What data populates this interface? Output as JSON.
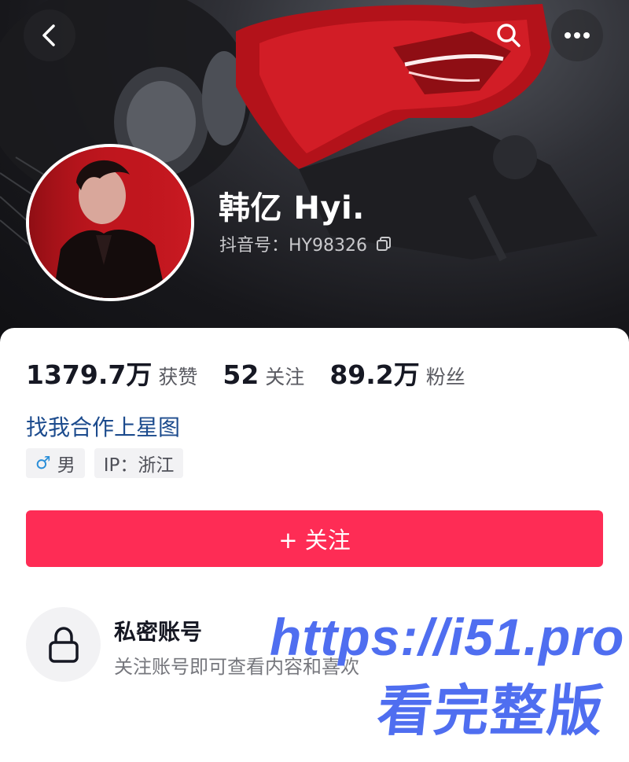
{
  "profile": {
    "nickname": "韩亿 Hyi.",
    "douyin_id": "抖音号：HY98326"
  },
  "stats": [
    {
      "value": "1379.7万",
      "label": "获赞"
    },
    {
      "value": "52",
      "label": "关注"
    },
    {
      "value": "89.2万",
      "label": "粉丝"
    }
  ],
  "collab_link": "找我合作上星图",
  "tags": {
    "gender": "男",
    "ip": "IP：浙江"
  },
  "follow_button": "+ 关注",
  "private_notice": {
    "title": "私密账号",
    "description": "关注账号即可查看内容和喜欢"
  },
  "watermark": {
    "url": "https://i51.pro",
    "text": "看完整版"
  },
  "colors": {
    "follow_button": "#fe2c55",
    "link": "#1c4b8d",
    "watermark": "#4f6ef0",
    "gender_icon": "#2a8ed8"
  },
  "icons": [
    "back-arrow-icon",
    "search-icon",
    "more-icon",
    "copy-icon",
    "male-icon",
    "lock-icon"
  ]
}
